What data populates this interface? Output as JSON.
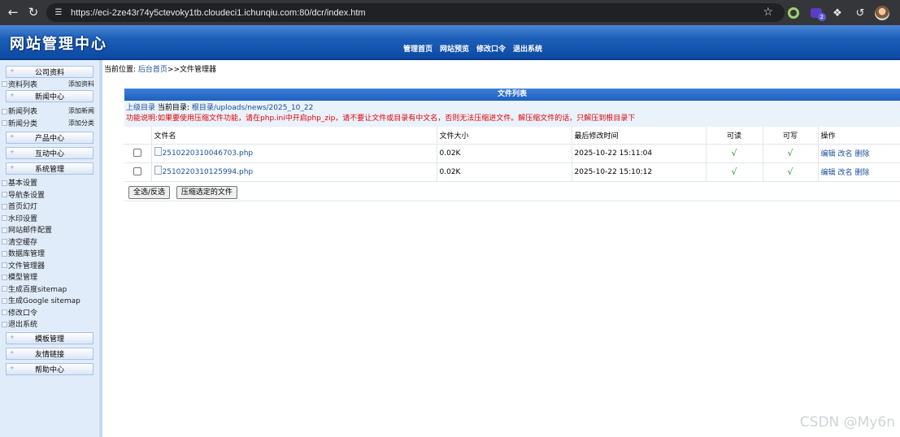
{
  "browser": {
    "url": "https://eci-2ze43r74y5ctevoky1tb.cloudeci1.ichunqiu.com:80/dcr/index.htm",
    "extension_badge": "2",
    "icons": [
      "back-icon",
      "reload-icon",
      "site-info-icon",
      "star-icon",
      "extension-ring-icon",
      "extension-purple-icon",
      "puzzle-icon",
      "history-icon",
      "avatar"
    ]
  },
  "header": {
    "logo": "网站管理中心",
    "nav": [
      "管理首页",
      "网站预览",
      "修改口令",
      "退出系统"
    ]
  },
  "sidebar": {
    "s1": "公司资料",
    "s1_row": {
      "left": "资料列表",
      "right": "添加资料"
    },
    "s2": "新闻中心",
    "s2_rows": [
      {
        "left": "新闻列表",
        "right": "添加新闻"
      },
      {
        "left": "新闻分类",
        "right": "添加分类"
      }
    ],
    "s3": "产品中心",
    "s4": "互动中心",
    "s5": "系统管理",
    "s5_items": [
      "基本设置",
      "导航条设置",
      "首页幻灯",
      "水印设置",
      "网站邮件配置",
      "清空缓存",
      "数据库管理",
      "文件管理器",
      "模型管理",
      "生成百度sitemap",
      "生成Google sitemap",
      "修改口令",
      "退出系统"
    ],
    "s6": "模板管理",
    "s7": "友情链接",
    "s8": "帮助中心"
  },
  "breadcrumb": {
    "prefix": "当前位置:",
    "home": "后台首页",
    "sep": ">>",
    "current": "文件管理器"
  },
  "panel": {
    "title": "文件列表",
    "parent_dir": "上级目录",
    "current_dir_label": "当前目录:",
    "current_dir": "根目录/uploads/news/2025_10_22",
    "notice": "功能说明:如果要使用压缩文件功能，请在php.ini中开启php_zip，请不要让文件或目录有中文名，否则无法压缩进文件。解压缩文件的话，只解压到根目录下"
  },
  "table": {
    "headers": [
      "文件名",
      "文件大小",
      "最后修改时间",
      "可读",
      "可写",
      "操作"
    ],
    "rows": [
      {
        "name": "2510220310046703.php",
        "size": "0.02K",
        "modified": "2025-10-22 15:11:04",
        "readable": "√",
        "writable": "√",
        "ops": [
          "编辑",
          "改名",
          "删除"
        ]
      },
      {
        "name": "2510220310125994.php",
        "size": "0.02K",
        "modified": "2025-10-22 15:10:12",
        "readable": "√",
        "writable": "√",
        "ops": [
          "编辑",
          "改名",
          "删除"
        ]
      }
    ],
    "select_all": "全选/反选",
    "compress": "压缩选定的文件"
  },
  "watermark": "CSDN @My6n"
}
